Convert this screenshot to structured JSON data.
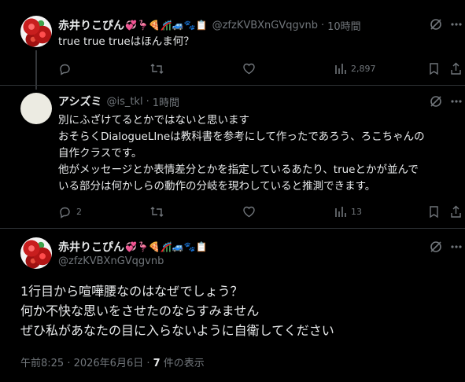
{
  "tweet1": {
    "name": "赤井りこぴん",
    "emoji": "💞🦩🍕🎢🚙🐾📋",
    "handle": "@zfzKVBXnGVqgvnb",
    "time": "10時間",
    "text": "true true trueはほんま何？",
    "views": "2,897"
  },
  "reply": {
    "name": "アシズミ",
    "handle": "@is_tkl",
    "time": "1時間",
    "lines": [
      "別にふざけてるとかではないと思います",
      "おそらくDialogueLIneは教科書を参考にして作ったであろう、ろこちゃんの",
      "自作クラスです。",
      "他がメッセージとか表情差分とかを指定しているあたり、trueとかが並んで",
      "いる部分は何かしらの動作の分岐を現わしていると推測できます。"
    ],
    "replies": "2",
    "views": "13"
  },
  "tweet2": {
    "name": "赤井りこぴん",
    "emoji": "💞🦩🍕🎢🚙🐾📋",
    "handle": "@zfzKVBXnGVqgvnb",
    "lines": [
      "1行目から喧嘩腰なのはなぜでしょう？",
      "何か不快な思いをさせたのならすみません",
      "ぜひ私があなたの目に入らないように自衛してください"
    ],
    "meta_time": "午前8:25 · 2026年6月6日 · ",
    "meta_views_count": "7",
    "meta_views_label": " 件の表示"
  }
}
